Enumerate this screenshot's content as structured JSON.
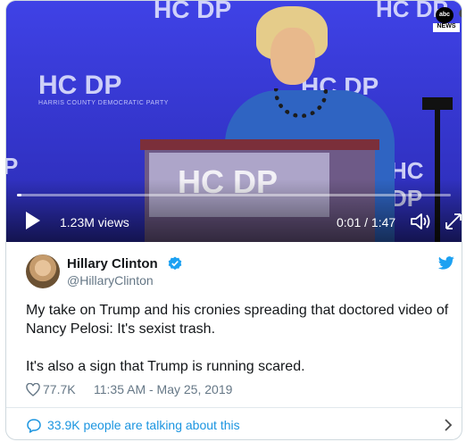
{
  "video": {
    "network_badge": "abc",
    "network_label": "NEWS",
    "logo_text": "HC DP",
    "logo_sub": "HARRIS COUNTY DEMOCRATIC PARTY",
    "views": "1.23M views",
    "time": "0:01 / 1:47",
    "progress_fraction": 0.01,
    "icons": [
      "play-icon",
      "volume-icon",
      "fullscreen-icon",
      "info-icon"
    ]
  },
  "tweet": {
    "author_name": "Hillary Clinton",
    "handle": "@HillaryClinton",
    "paragraphs": [
      "My take on Trump and his cronies spreading that doctored video of Nancy Pelosi: It's sexist trash.",
      "It's also a sign that Trump is running scared."
    ],
    "likes": "77.7K",
    "timestamp": "11:35 AM - May 25, 2019",
    "talking": "33.9K people are talking about this"
  },
  "colors": {
    "twitter_blue": "#1da1f2",
    "link_blue": "#1b95e0",
    "muted": "#657786",
    "text": "#14171a"
  }
}
